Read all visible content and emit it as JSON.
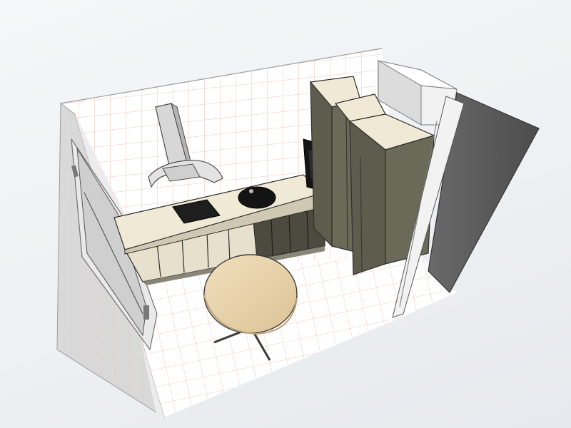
{
  "scene": {
    "kind": "3d-kitchen-planner-view",
    "colors": {
      "background": "#eef0f3",
      "grid_line": "#e8b4a8",
      "wall_white": "#ffffff",
      "wall_shade": "#d9d9d9",
      "floor": "#ffffff",
      "cabinet_front": "#e6e0cc",
      "cabinet_dark": "#4d4b40",
      "tall_unit": "#6b6a58",
      "countertop": "#efe9d5",
      "table_top": "#e7d2aa",
      "glass_panel": "#5a5a5a",
      "hob": "#1e1e1e",
      "sink": "#141414"
    },
    "objects": [
      {
        "name": "back-wall",
        "type": "wall"
      },
      {
        "name": "left-wall",
        "type": "wall"
      },
      {
        "name": "floor",
        "type": "floor"
      },
      {
        "name": "window",
        "type": "window"
      },
      {
        "name": "range-hood",
        "type": "appliance"
      },
      {
        "name": "base-cabinet-run",
        "type": "cabinet"
      },
      {
        "name": "countertop",
        "type": "worktop"
      },
      {
        "name": "cooktop",
        "type": "appliance"
      },
      {
        "name": "sink",
        "type": "fixture"
      },
      {
        "name": "built-in-oven",
        "type": "appliance"
      },
      {
        "name": "tall-cabinet-column",
        "type": "cabinet"
      },
      {
        "name": "refrigerator-column",
        "type": "appliance"
      },
      {
        "name": "wall-box-unit",
        "type": "cabinet"
      },
      {
        "name": "glass-partition",
        "type": "partition"
      },
      {
        "name": "round-dining-table",
        "type": "furniture"
      }
    ]
  }
}
